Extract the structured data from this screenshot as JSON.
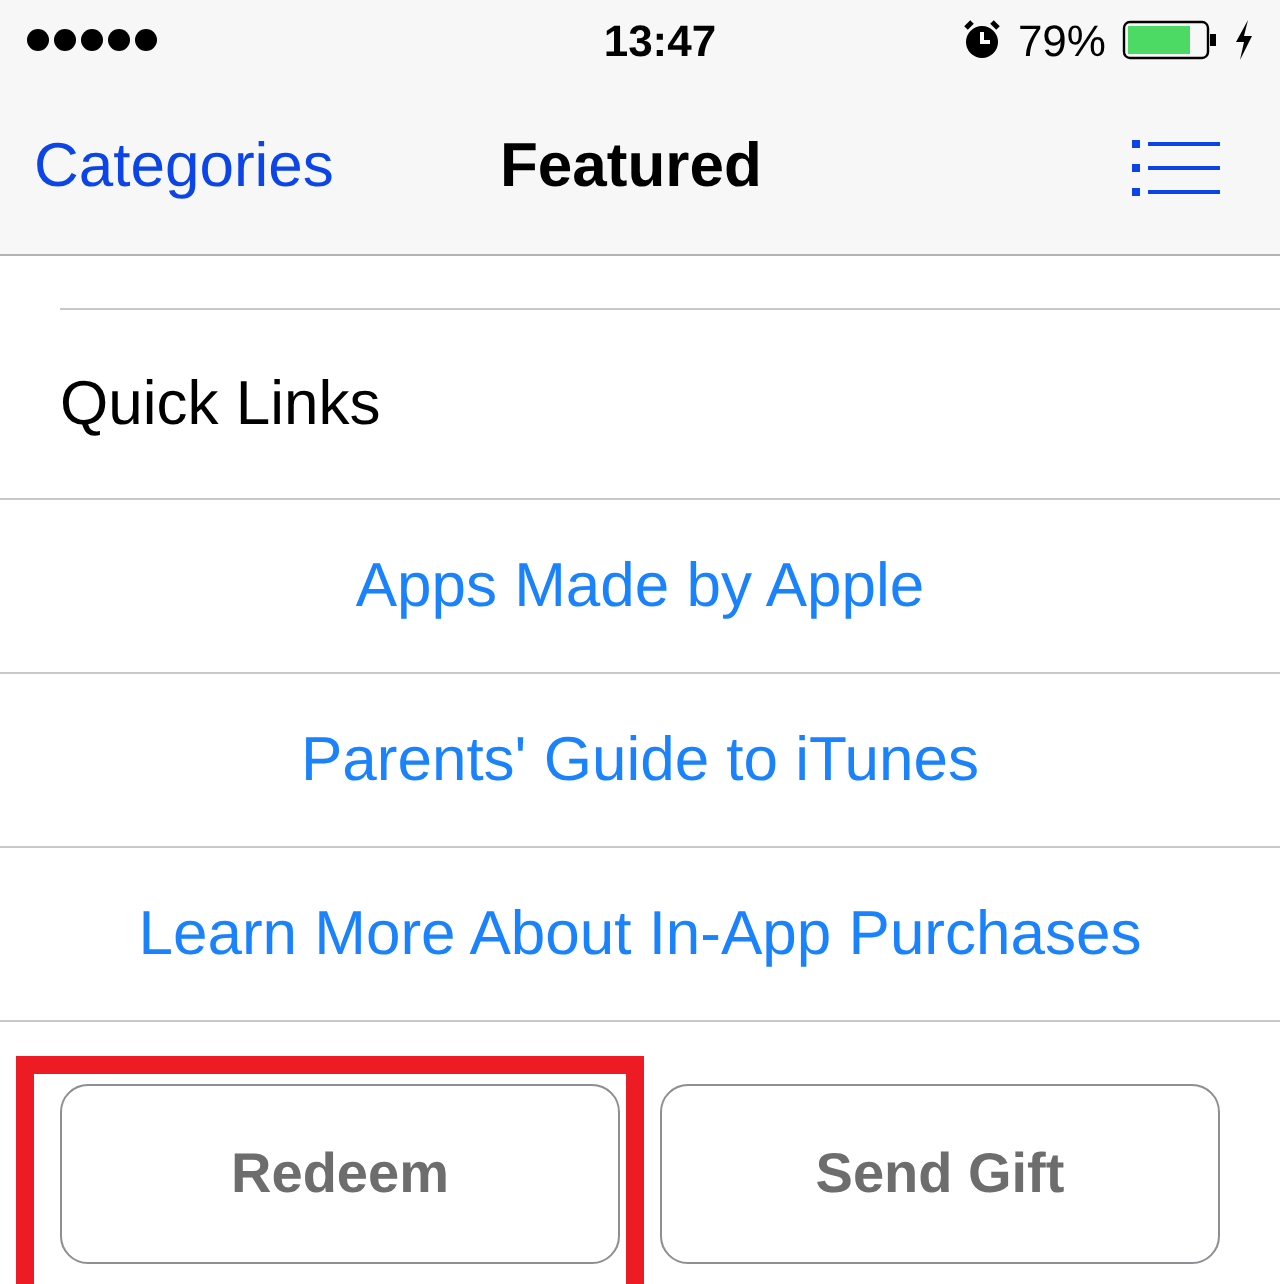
{
  "status_bar": {
    "time": "13:47",
    "battery": "79%"
  },
  "nav_bar": {
    "back": "Categories",
    "title": "Featured"
  },
  "section": {
    "title": "Quick Links"
  },
  "links": [
    "Apps Made by Apple",
    "Parents' Guide to iTunes",
    "Learn More About In-App Purchases"
  ],
  "buttons": [
    {
      "label": "Redeem",
      "highlighted": true
    },
    {
      "label": "Send Gift",
      "highlighted": false
    }
  ]
}
